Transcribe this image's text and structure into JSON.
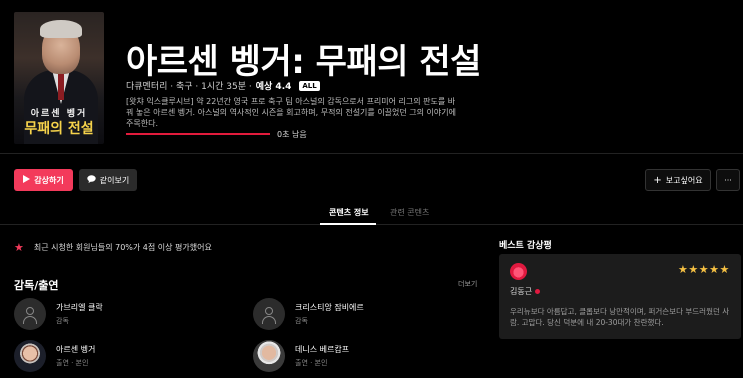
{
  "poster": {
    "title_line1": "아르센 벵거",
    "title_line2": "무패의 전설"
  },
  "title": "아르센 벵거: 무패의 전설",
  "meta": {
    "info": "다큐멘터리 · 축구 · 1시간 35분 ·",
    "score_label": "예상 4.4",
    "rating_badge": "ALL"
  },
  "description": "[왓챠 익스클루시브] 약 22년간 영국 프로 축구 팀 아스널의 감독으로서 프리미어 리그의 판도를 바꿔 놓은 아르센 벵거. 아스널의 역사적인 시즌을 회고하며, 무적의 전설기를 이끌었던 그의 이야기에 주목한다.",
  "progress": {
    "fraction": 1.0,
    "remaining_text": "0초 남음"
  },
  "buttons": {
    "watch": "감상하기",
    "together": "같이보기",
    "wishlist": "보고싶어요",
    "more": "···"
  },
  "tabs": {
    "info": "콘텐츠 정보",
    "related": "관련 콘텐츠"
  },
  "notice": "최근 시청한 회원님들의 70%가 4점 이상 평가했어요",
  "cast": {
    "heading": "감독/출연",
    "more_link": "더보기",
    "people": [
      {
        "name": "가브리엘 클락",
        "role": "감독"
      },
      {
        "name": "크리스티앙 잠비에르",
        "role": "감독"
      },
      {
        "name": "아르센 벵거",
        "role": "출연 · 본인"
      },
      {
        "name": "데니스 베르캄프",
        "role": "출연 · 본인"
      }
    ]
  },
  "reviews": {
    "heading": "베스트 감상평",
    "items": [
      {
        "stars": "★★★★★",
        "rating": 5,
        "user": "김동근",
        "text": "우리뉴보다 아름답고, 클롭보다 낭만적이며, 퍼거슨보다 부드러웠던 사람. 고맙다. 당신 덕분에 내 20-30대가 찬란했다."
      }
    ]
  },
  "colors": {
    "accent": "#f33a5b",
    "star": "#f5c043",
    "background": "#000000"
  }
}
